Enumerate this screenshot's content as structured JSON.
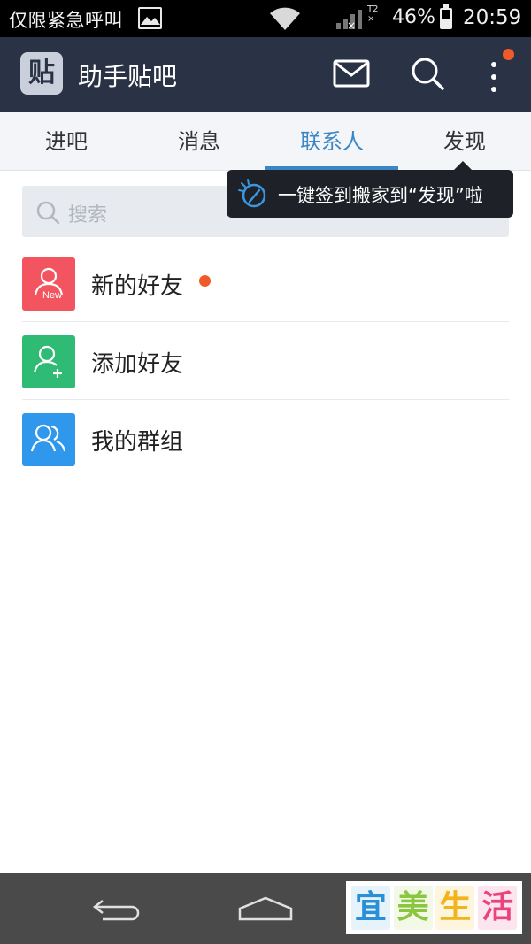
{
  "status_bar": {
    "carrier": "仅限紧急呼叫",
    "network_tag": "T2",
    "battery": "46%",
    "battery_level": 0.46,
    "time": "20:59"
  },
  "app_bar": {
    "logo_char": "贴",
    "title": "助手贴吧",
    "actions": [
      "mail-icon",
      "search-icon",
      "more-icon"
    ],
    "has_notification": true
  },
  "tabs": [
    {
      "label": "进吧",
      "active": false
    },
    {
      "label": "消息",
      "active": false
    },
    {
      "label": "联系人",
      "active": true
    },
    {
      "label": "发现",
      "active": false
    }
  ],
  "search": {
    "placeholder": "搜索"
  },
  "tooltip": {
    "text": "一键签到搬家到“发现”啦"
  },
  "contacts": [
    {
      "label": "新的好友",
      "icon": "new-friend-icon",
      "icon_color": "#f2555f",
      "badge_text": "New",
      "has_dot": true
    },
    {
      "label": "添加好友",
      "icon": "add-friend-icon",
      "icon_color": "#2fbb73",
      "has_dot": false
    },
    {
      "label": "我的群组",
      "icon": "group-icon",
      "icon_color": "#2f98ec",
      "has_dot": false
    }
  ],
  "nav": {
    "buttons": [
      "back-icon",
      "home-icon"
    ]
  },
  "watermark": {
    "chars": [
      "宜",
      "美",
      "生",
      "活"
    ],
    "colors": [
      "#2b8fd8",
      "#8ac63f",
      "#f2b41d",
      "#e9447c"
    ],
    "backgrounds": [
      "#e6f3fb",
      "#f2f9e6",
      "#fdf5de",
      "#fce5ee"
    ]
  },
  "colors": {
    "app_bar": "#2a3245",
    "accent": "#3b87c6",
    "notification": "#f05a28"
  }
}
